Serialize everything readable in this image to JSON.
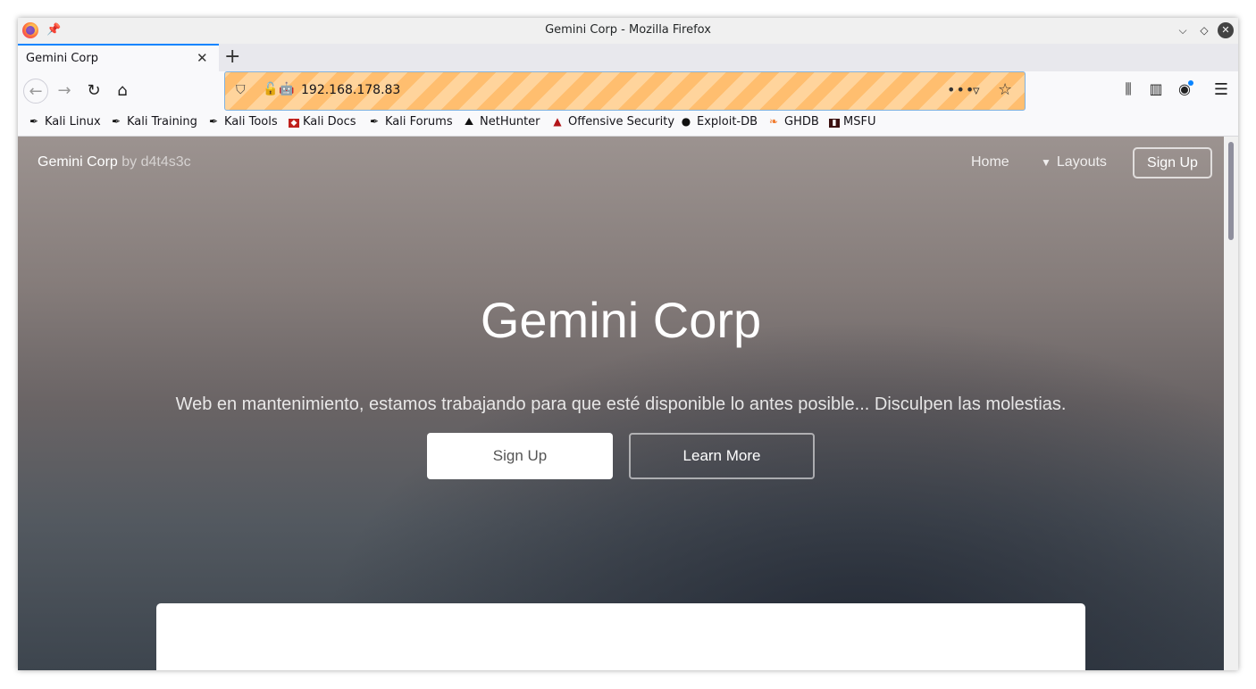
{
  "window": {
    "title": "Gemini Corp - Mozilla Firefox"
  },
  "tab": {
    "label": "Gemini Corp"
  },
  "urlbar": {
    "url": "192.168.178.83"
  },
  "bookmarks": [
    {
      "label": "Kali Linux",
      "icon": "kali-dragon-icon"
    },
    {
      "label": "Kali Training",
      "icon": "kali-dragon-icon"
    },
    {
      "label": "Kali Tools",
      "icon": "kali-dragon-icon"
    },
    {
      "label": "Kali Docs",
      "icon": "kali-docs-icon"
    },
    {
      "label": "Kali Forums",
      "icon": "kali-dragon-icon"
    },
    {
      "label": "NetHunter",
      "icon": "nethunter-icon"
    },
    {
      "label": "Offensive Security",
      "icon": "offsec-icon"
    },
    {
      "label": "Exploit-DB",
      "icon": "exploitdb-icon"
    },
    {
      "label": "GHDB",
      "icon": "ghdb-icon"
    },
    {
      "label": "MSFU",
      "icon": "msfu-icon"
    }
  ],
  "site": {
    "brand": "Gemini Corp",
    "brand_by": "by d4t4s3c",
    "nav_home": "Home",
    "nav_layouts": "Layouts",
    "nav_signup": "Sign Up",
    "hero_title": "Gemini Corp",
    "hero_subtitle": "Web en mantenimiento, estamos trabajando para que esté disponible lo antes posible... Disculpen las molestias.",
    "hero_signup": "Sign Up",
    "hero_learn_more": "Learn More"
  },
  "colors": {
    "url_stripe_a": "#ffbe6f",
    "url_stripe_b": "#ffd49c",
    "accent": "#0a84ff"
  }
}
